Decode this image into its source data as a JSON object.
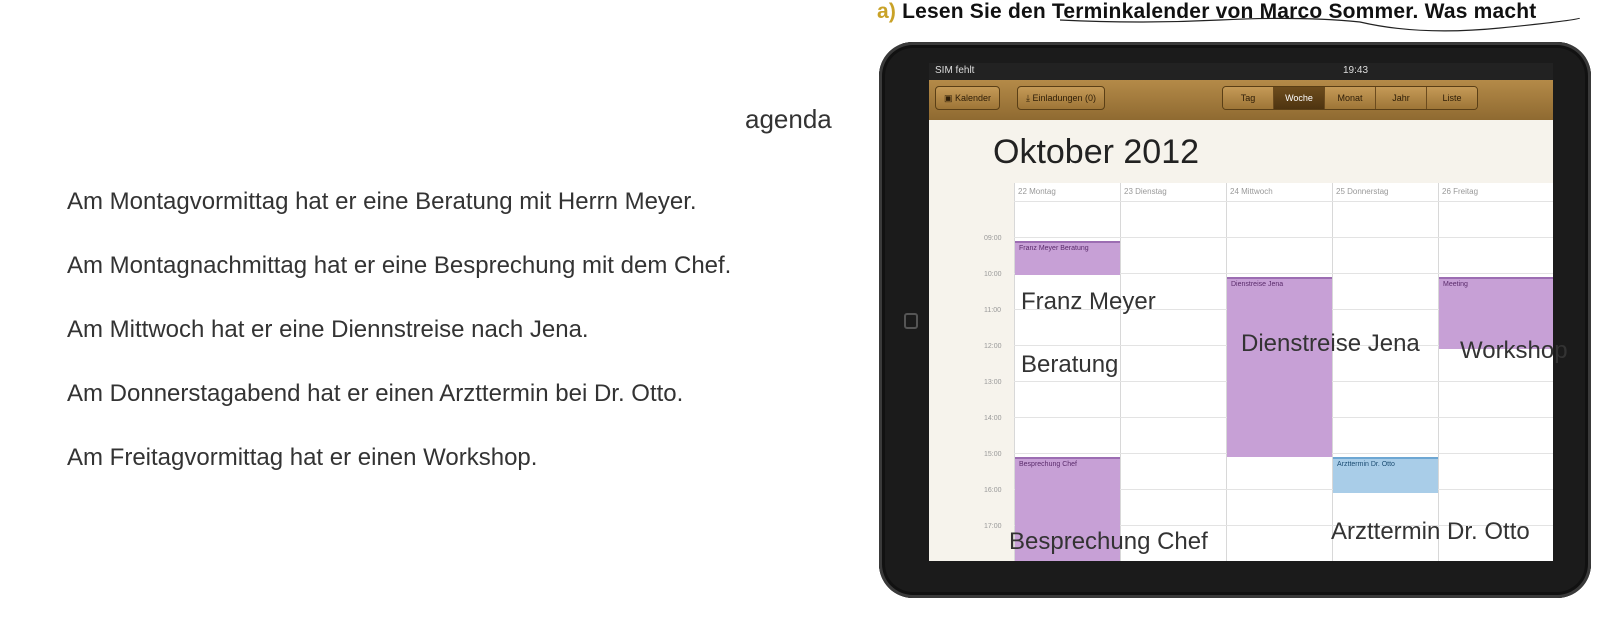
{
  "heading": {
    "letter": "a)",
    "text": "Lesen Sie den Terminkalender von Marco Sommer. Was macht"
  },
  "agenda_label": "agenda",
  "sentences": [
    "Am Montagvormittag hat er eine Beratung mit Herrn Meyer.",
    "Am Montagnachmittag hat er eine Besprechung mit dem Chef.",
    "Am Mittwoch hat er eine Diennstreise nach Jena.",
    "Am Donnerstagabend hat er einen Arzttermin bei Dr. Otto.",
    "Am Freitagvormittag hat er einen Workshop."
  ],
  "ipad": {
    "status": {
      "carrier": "SIM fehlt",
      "time": "19:43"
    },
    "toolbar": {
      "calendars_btn": "Kalender",
      "invitations_btn": "Einladungen (0)",
      "views": [
        "Tag",
        "Woche",
        "Monat",
        "Jahr",
        "Liste"
      ],
      "active_view": "Woche"
    },
    "month_title": "Oktober 2012",
    "days": [
      "22 Montag",
      "23 Dienstag",
      "24 Mittwoch",
      "25 Donnerstag",
      "26 Freitag"
    ],
    "hours": [
      "09:00",
      "10:00",
      "11:00",
      "12:00",
      "13:00",
      "14:00",
      "15:00",
      "16:00",
      "17:00"
    ],
    "events": {
      "franz": "Franz Meyer Beratung",
      "dienstreise": "Dienstreise Jena",
      "meeting": "Meeting",
      "besprechung": "Besprechung Chef",
      "arzt": "Arzttermin Dr. Otto"
    }
  },
  "overlay_labels": {
    "franz_meyer": "Franz Meyer",
    "beratung": "Beratung",
    "dienstreise_jena": "Dienstreise Jena",
    "workshop": "Workshop",
    "besprechung_chef": "Besprechung Chef",
    "arzttermin": "Arzttermin Dr. Otto"
  },
  "colors": {
    "event_purple": "#c7a0d6",
    "event_blue": "#a9cde8",
    "toolbar_wood": "#a67c3e",
    "heading_accent": "#c9a227"
  }
}
